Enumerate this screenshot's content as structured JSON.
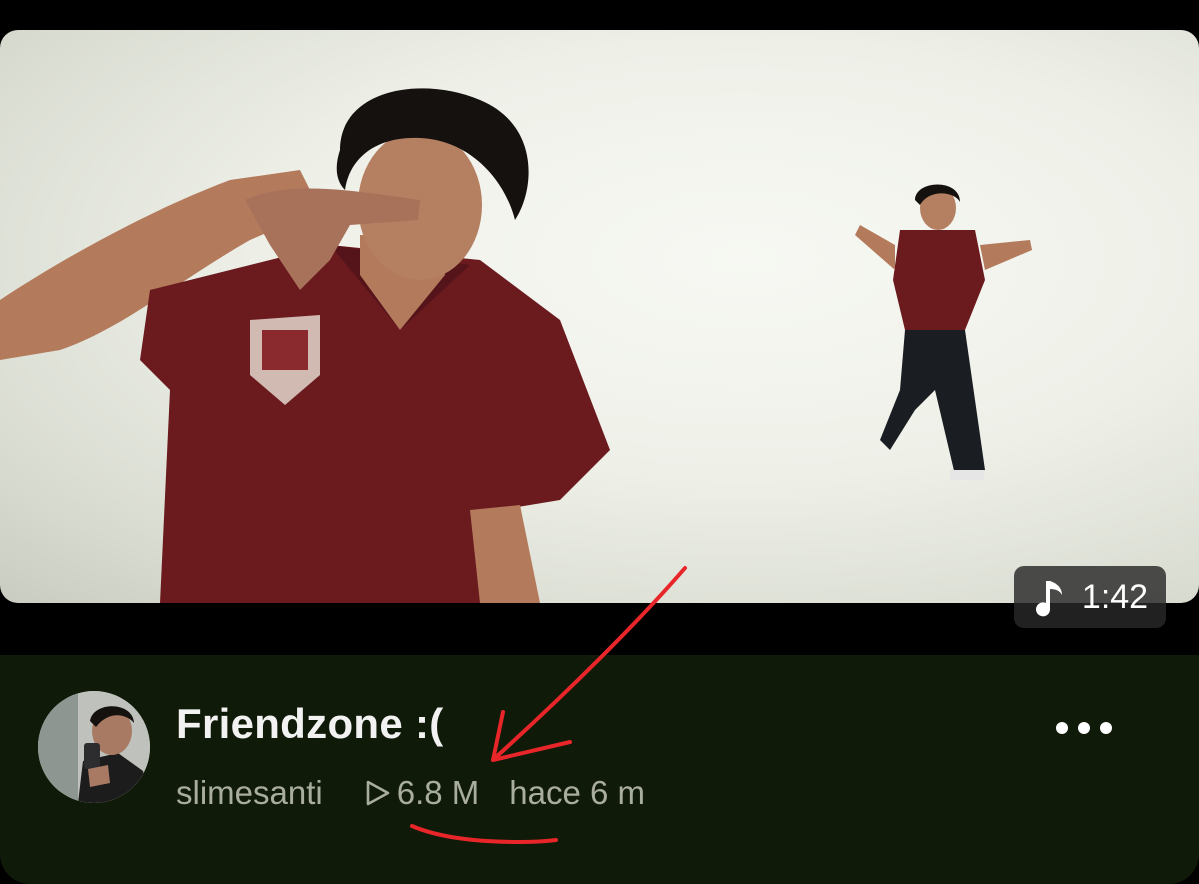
{
  "video": {
    "title": "Friendzone :(",
    "channel": "slimesanti",
    "views": "6.8 M",
    "age": "hace 6 m",
    "duration": "1:42"
  },
  "icons": {
    "duration": "music-note-icon",
    "views": "play-outline-icon",
    "menu": "more-horizontal-icon"
  },
  "colors": {
    "card_background": "#101a08",
    "title_text": "#f2f2f2",
    "meta_text": "#a9ad9f",
    "annotation": "#e8262a"
  }
}
